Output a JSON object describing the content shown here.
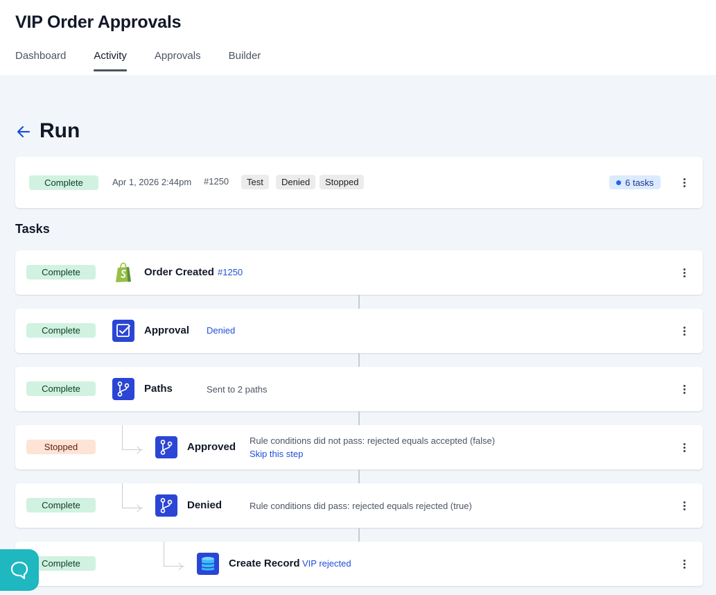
{
  "app": {
    "title": "VIP Order Approvals"
  },
  "tabs": [
    {
      "label": "Dashboard"
    },
    {
      "label": "Activity"
    },
    {
      "label": "Approvals"
    },
    {
      "label": "Builder"
    }
  ],
  "page": {
    "title": "Run"
  },
  "run": {
    "status": "Complete",
    "date": "Apr 1, 2026 2:44pm",
    "number": "#1250",
    "tags": [
      "Test",
      "Denied",
      "Stopped"
    ],
    "tasks_count": "6 tasks"
  },
  "tasks_section": {
    "title": "Tasks"
  },
  "tasks": [
    {
      "status": "Complete",
      "name": "Order Created",
      "link": "#1250",
      "icon": "shopify-bag-icon"
    },
    {
      "status": "Complete",
      "name": "Approval",
      "link": "Denied",
      "icon": "approval-check-icon"
    },
    {
      "status": "Complete",
      "name": "Paths",
      "info": "Sent to 2 paths",
      "icon": "paths-branch-icon"
    },
    {
      "status": "Stopped",
      "name": "Approved",
      "info": "Rule conditions did not pass: rejected equals accepted (false)",
      "link": "Skip this step",
      "icon": "paths-branch-icon"
    },
    {
      "status": "Complete",
      "name": "Denied",
      "info": "Rule conditions did pass: rejected equals rejected (true)",
      "icon": "paths-branch-icon"
    },
    {
      "status": "Complete",
      "name": "Create Record",
      "link": "VIP rejected",
      "icon": "database-icon"
    }
  ],
  "colors": {
    "complete_bg": "#d1f2e1",
    "stopped_bg": "#fde4d6",
    "task_icon_blue": "#2b45d4",
    "link_blue": "#1d4ed8",
    "chat_teal": "#1fb7c0"
  }
}
